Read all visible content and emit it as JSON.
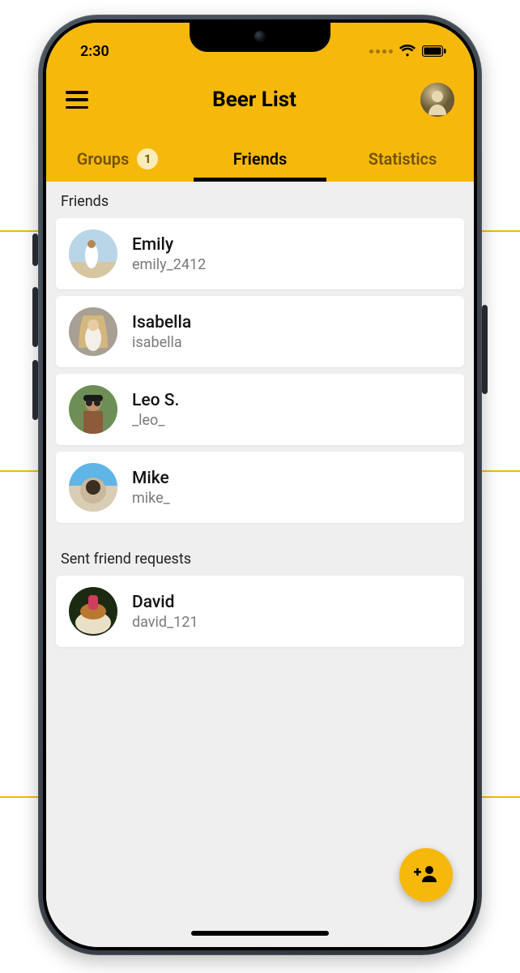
{
  "statusbar": {
    "time": "2:30"
  },
  "header": {
    "title": "Beer List"
  },
  "tabs": {
    "groups": {
      "label": "Groups",
      "badge": "1"
    },
    "friends": {
      "label": "Friends"
    },
    "statistics": {
      "label": "Statistics"
    }
  },
  "sections": {
    "friends_title": "Friends",
    "sent_title": "Sent friend requests"
  },
  "friends": [
    {
      "name": "Emily",
      "handle": "emily_2412"
    },
    {
      "name": "Isabella",
      "handle": "isabella"
    },
    {
      "name": "Leo S.",
      "handle": "_leo_"
    },
    {
      "name": "Mike",
      "handle": "mike_"
    }
  ],
  "sent_requests": [
    {
      "name": "David",
      "handle": "david_121"
    }
  ],
  "colors": {
    "accent": "#f7b80c",
    "badge_bg": "#fcecb8",
    "subtext": "#7a7a7a"
  }
}
